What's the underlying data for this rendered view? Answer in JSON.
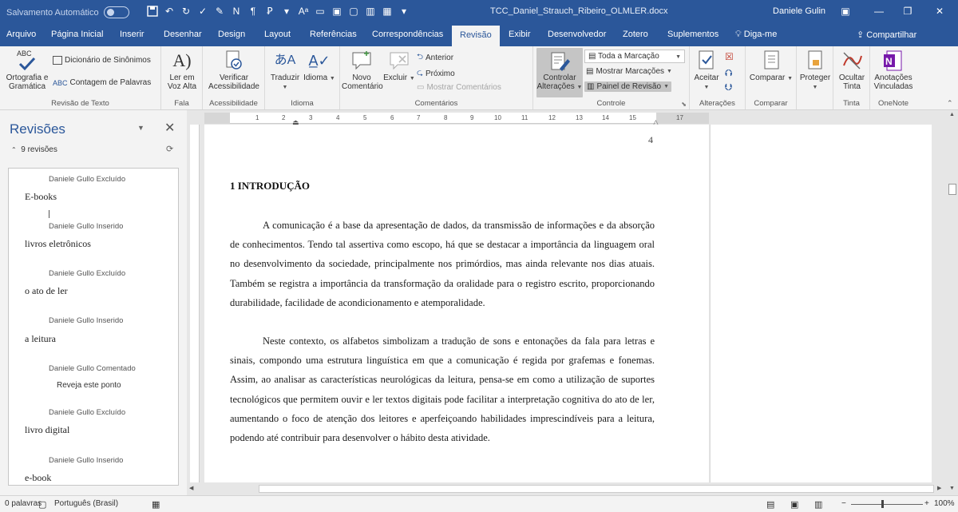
{
  "titlebar": {
    "autosave_label": "Salvamento Automático",
    "doc_title": "TCC_Daniel_Strauch_Ribeiro_OLMLER.docx",
    "user": "Daniele Gulin",
    "qat_icons": [
      "save-icon",
      "undo-icon",
      "redo-icon",
      "paintbrush-icon",
      "pilcrow-icon",
      "table-icon"
    ]
  },
  "tabs": [
    "Arquivo",
    "Página Inicial",
    "Inserir",
    "Desenhar",
    "Design",
    "Layout",
    "Referências",
    "Correspondências",
    "Revisão",
    "Exibir",
    "Desenvolvedor",
    "Zotero",
    "Suplementos"
  ],
  "active_tab": "Revisão",
  "tell_me": "Diga-me",
  "share": "Compartilhar",
  "ribbon": {
    "proofing": {
      "label": "Revisão de Texto",
      "spelling": "Ortografia e Gramática",
      "abc": "ABC",
      "thesaurus": "Dicionário de Sinônimos",
      "word_count": "Contagem de Palavras"
    },
    "speech": {
      "label": "Fala",
      "read_aloud": "Ler em Voz Alta"
    },
    "accessibility": {
      "label": "Acessibilidade",
      "check": "Verificar Acessibilidade"
    },
    "language": {
      "label": "Idioma",
      "translate": "Traduzir",
      "language": "Idioma"
    },
    "comments": {
      "label": "Comentários",
      "new": "Novo Comentário",
      "delete": "Excluir",
      "previous": "Anterior",
      "next": "Próximo",
      "show": "Mostrar Comentários"
    },
    "tracking": {
      "label": "Controle",
      "track_changes": "Controlar Alterações",
      "markup_select": "Toda a Marcação",
      "show_markup": "Mostrar Marcações",
      "reviewing_pane": "Painel de Revisão"
    },
    "changes": {
      "label": "Alterações",
      "accept": "Aceitar"
    },
    "compare": {
      "label": "Comparar",
      "compare": "Comparar"
    },
    "protect": {
      "protect": "Proteger"
    },
    "ink": {
      "label": "Tinta",
      "hide_ink": "Ocultar Tinta"
    },
    "onenote": {
      "label": "OneNote",
      "linked_notes": "Anotações Vinculadas"
    }
  },
  "nav": {
    "title": "Revisões",
    "count": "9 revisões",
    "revisions": [
      {
        "author": "Daniele Gullo Excluído",
        "text": "E-books"
      },
      {
        "author": "Daniele Gullo Inserido",
        "text": "livros eletrônicos"
      },
      {
        "author": "Daniele Gullo Excluído",
        "text": "o ato de ler"
      },
      {
        "author": "Daniele Gullo Inserido",
        "text": "a leitura"
      },
      {
        "author": "Daniele Gullo Comentado",
        "text": "Reveja este ponto"
      },
      {
        "author": "Daniele Gullo Excluído",
        "text": "livro digital"
      },
      {
        "author": "Daniele Gullo Inserido",
        "text": "e-book"
      }
    ]
  },
  "ruler": {
    "numbers": [
      "1",
      "2",
      "3",
      "4",
      "5",
      "6",
      "7",
      "8",
      "9",
      "10",
      "11",
      "12",
      "13",
      "14",
      "15",
      "17"
    ]
  },
  "document": {
    "page_number": "4",
    "heading": "1 INTRODUÇÃO",
    "paragraphs": [
      "A comunicação é a base da apresentação de dados, da transmissão de informações e da absorção de conhecimentos. Tendo tal assertiva como escopo, há que se destacar a importância da linguagem oral no desenvolvimento da sociedade, principalmente nos primórdios, mas ainda relevante nos dias atuais. Também se registra a importância da transformação da oralidade para o registro escrito, proporcionando durabilidade, facilidade de acondicionamento e atemporalidade.",
      "Neste contexto, os alfabetos simbolizam a tradução de sons e entonações da fala para letras e sinais, compondo uma estrutura linguística em que a comunicação é regida por grafemas e fonemas. Assim, ao analisar as características neurológicas da leitura, pensa-se em como a utilização de suportes tecnológicos que permitem ouvir e ler textos digitais pode facilitar a interpretação cognitiva do ato de ler, aumentando o foco de atenção dos leitores e aperfeiçoando habilidades imprescindíveis para a leitura, podendo até contribuir para desenvolver o hábito desta atividade."
    ]
  },
  "status": {
    "words": "0 palavras",
    "language": "Português (Brasil)",
    "zoom": "100%"
  },
  "colors": {
    "word_blue": "#2b579a",
    "ribbon_bg": "#f3f3f3"
  }
}
